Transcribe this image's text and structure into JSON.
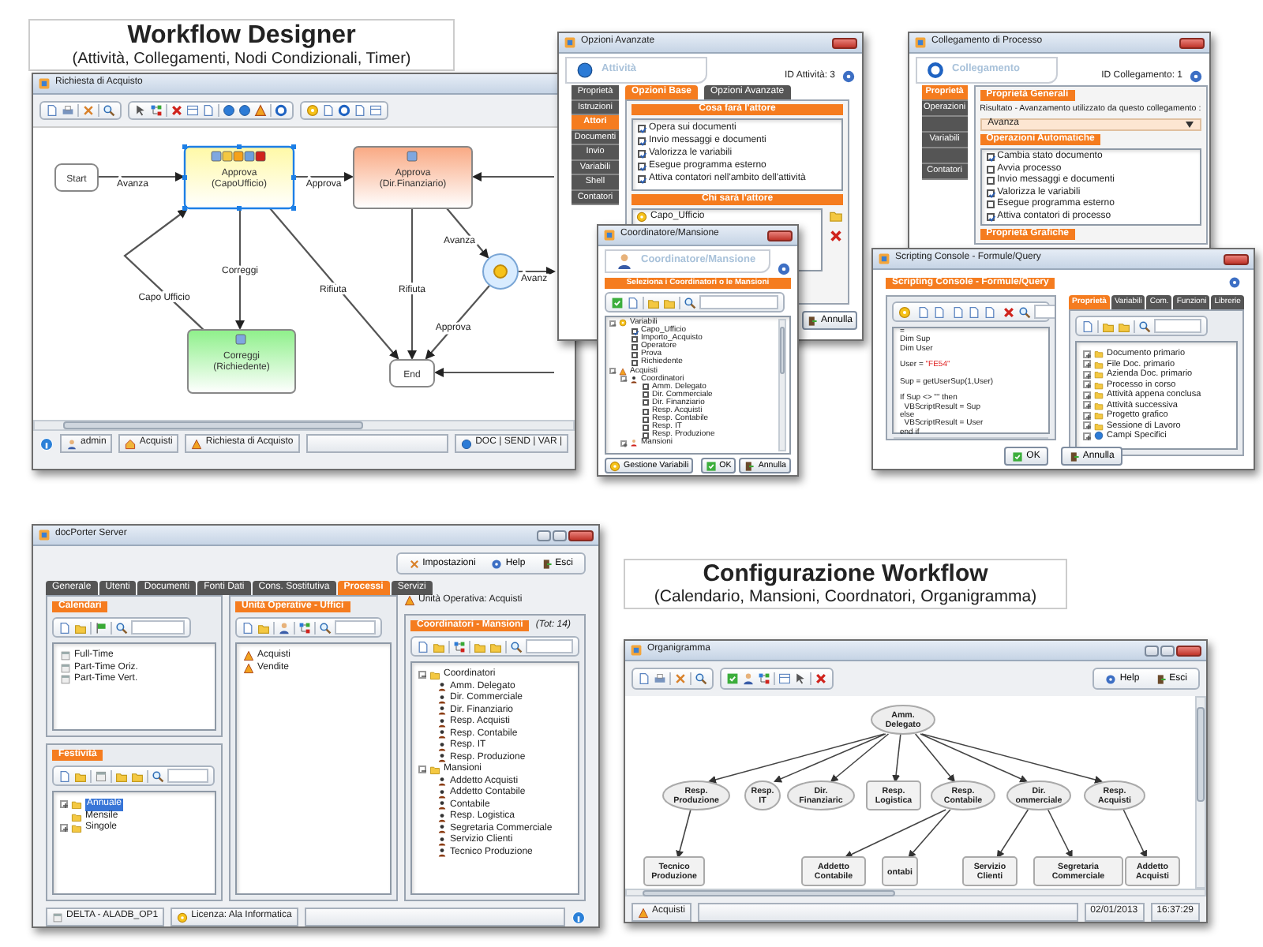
{
  "captions": [
    {
      "title": "Workflow Designer",
      "subtitle": "(Attività, Collegamenti, Nodi Condizionali, Timer)"
    },
    {
      "title": "Configurazione Workflow",
      "subtitle": "(Calendario, Mansioni, Coordnatori, Organigramma)"
    }
  ],
  "designer": {
    "title": "Richiesta di Acquisto",
    "nodes": [
      {
        "kind": "terminal",
        "label": "Start",
        "selected": false
      },
      {
        "kind": "activity",
        "label": "Approva",
        "sublabel": "(CapoUfficio)",
        "color": "#fff9a6",
        "selected": true
      },
      {
        "kind": "activity",
        "label": "Approva",
        "sublabel": "(Dir.Finanziario)",
        "color": "#f9a983",
        "selected": false
      },
      {
        "kind": "activity",
        "label": "Correggi",
        "sublabel": "(Richiedente)",
        "color": "#8ef08a",
        "selected": false
      },
      {
        "kind": "terminal",
        "label": "End",
        "selected": false
      },
      {
        "kind": "condition",
        "selected": false
      }
    ],
    "links": [
      {
        "kind": "link",
        "label": "Avanza"
      },
      {
        "kind": "link",
        "label": "Approva"
      },
      {
        "kind": "link"
      },
      {
        "kind": "link",
        "label": "Correggi"
      },
      {
        "kind": "link",
        "label": "Capo Ufficio"
      },
      {
        "kind": "link",
        "label": "Rifiuta"
      },
      {
        "kind": "link",
        "label": "Rifiuta"
      },
      {
        "kind": "link",
        "label": "Avanza"
      },
      {
        "kind": "link",
        "label": "Approva"
      },
      {
        "kind": "link",
        "label": "Avanz"
      },
      {
        "kind": "link"
      }
    ],
    "status": [
      "admin",
      "Acquisti",
      "Richiesta di Acquisto"
    ],
    "status_right": "DOC | SEND | VAR |"
  },
  "activity_dialog": {
    "title": "Opzioni Avanzate",
    "header": "Attività",
    "id_label": "ID Attività: 3",
    "side_tabs": [
      {
        "label": "Proprietà",
        "selected": false
      },
      {
        "label": "Istruzioni",
        "selected": false
      },
      {
        "label": "Attori",
        "selected": true
      },
      {
        "label": "Documenti",
        "selected": false
      },
      {
        "label": "Invio",
        "selected": false
      },
      {
        "label": "Variabili",
        "selected": false
      },
      {
        "label": "Shell",
        "selected": false
      },
      {
        "label": "Contatori",
        "selected": false
      }
    ],
    "tabs": [
      {
        "label": "Opzioni Base",
        "selected": true
      },
      {
        "label": "Opzioni Avanzate",
        "selected": false
      }
    ],
    "section_1": "Cosa farà l'attore",
    "options": [
      {
        "label": "Opera sui documenti",
        "checked": true
      },
      {
        "label": "Invio messaggi e documenti",
        "checked": true
      },
      {
        "label": "Valorizza le variabili",
        "checked": true
      },
      {
        "label": "Esegue programma esterno",
        "checked": true
      },
      {
        "label": "Attiva contatori nell'ambito dell'attività",
        "checked": true
      }
    ],
    "section_2": "Chi sarà l'attore",
    "actors": [
      "Capo_Ufficio"
    ],
    "buttons": [
      "Annulla"
    ]
  },
  "role_dialog": {
    "title": "Coordinatore/Mansione",
    "header": "Coordinatore/Mansione",
    "section": "Seleziona i Coordinatori o le Mansioni",
    "tree": [
      {
        "kind": "variables",
        "label": "Variabili",
        "expanded": true,
        "children": [
          {
            "label": "Capo_Ufficio",
            "checked": true
          },
          {
            "label": "Importo_Acquisto",
            "checked": false
          },
          {
            "label": "Operatore",
            "checked": false
          },
          {
            "label": "Prova",
            "checked": false
          },
          {
            "label": "Richiedente",
            "checked": false
          }
        ]
      },
      {
        "kind": "unit",
        "label": "Acquisti",
        "expanded": true,
        "children": [
          {
            "kind": "coordinator",
            "label": "Coordinatori",
            "expanded": true,
            "children": [
              {
                "label": "Amm. Delegato",
                "checked": false
              },
              {
                "label": "Dir. Commerciale",
                "checked": false
              },
              {
                "label": "Dir. Finanziario",
                "checked": false
              },
              {
                "label": "Resp. Acquisti",
                "checked": false
              },
              {
                "label": "Resp. Contabile",
                "checked": false
              },
              {
                "label": "Resp. IT",
                "checked": false
              },
              {
                "label": "Resp. Produzione",
                "checked": false
              }
            ]
          },
          {
            "kind": "role",
            "label": "Mansioni",
            "expanded": false
          }
        ]
      }
    ],
    "buttons": [
      "Gestione Variabili",
      "OK",
      "Annulla"
    ]
  },
  "link_dialog": {
    "title": "Collegamento di Processo",
    "header": "Collegamento",
    "id_label": "ID Collegamento: 1",
    "side_tabs": [
      {
        "kind": "tab",
        "label": "Proprietà",
        "selected": true
      },
      {
        "kind": "tab",
        "label": "Operazioni",
        "selected": false
      },
      {
        "kind": "blank",
        "selected": false
      },
      {
        "kind": "tab",
        "label": "Variabili",
        "selected": false
      },
      {
        "kind": "blank",
        "selected": false
      },
      {
        "kind": "tab",
        "label": "Contatori",
        "selected": false
      }
    ],
    "section_1": "Proprietà Generali",
    "result_label": "Risultato - Avanzamento utilizzato da questo collegamento :",
    "result_value": "Avanza",
    "section_2": "Operazioni Automatiche",
    "options": [
      {
        "label": "Cambia stato documento",
        "checked": true
      },
      {
        "label": "Avvia processo",
        "checked": false
      },
      {
        "label": "Invio messaggi e documenti",
        "checked": false
      },
      {
        "label": "Valorizza le variabili",
        "checked": true
      },
      {
        "label": "Esegue programma esterno",
        "checked": false
      },
      {
        "label": "Attiva contatori di processo",
        "checked": true
      }
    ],
    "section_3": "Proprietà Grafiche"
  },
  "script_dialog": {
    "title": "Scripting Console - Formule/Query",
    "header": "Scripting Console - Formule/Query",
    "code": [
      {
        "kind": "line",
        "text": "="
      },
      {
        "kind": "line",
        "text": "Dim Sup"
      },
      {
        "kind": "line",
        "text": "Dim User"
      },
      {
        "kind": "blank"
      },
      {
        "kind": "line",
        "text": "User = ",
        "literal": "\"FE54\""
      },
      {
        "kind": "blank"
      },
      {
        "kind": "line",
        "text": "Sup = getUserSup(1,User)"
      },
      {
        "kind": "blank"
      },
      {
        "kind": "line",
        "text": "If Sup <> \"\" then"
      },
      {
        "kind": "line",
        "text": "  VBScriptResult = Sup"
      },
      {
        "kind": "line",
        "text": "else"
      },
      {
        "kind": "line",
        "text": "  VBScriptResult = User"
      },
      {
        "kind": "line",
        "text": "end if"
      }
    ],
    "tabs": [
      {
        "label": "Proprietà",
        "selected": true
      },
      {
        "label": "Variabili",
        "selected": false
      },
      {
        "label": "Com.",
        "selected": false
      },
      {
        "label": "Funzioni",
        "selected": false
      },
      {
        "label": "Librerie",
        "selected": false
      }
    ],
    "tree": [
      {
        "kind": "folder",
        "label": "Documento primario"
      },
      {
        "kind": "folder",
        "label": "File Doc. primario"
      },
      {
        "kind": "folder",
        "label": "Azienda Doc. primario"
      },
      {
        "kind": "folder",
        "label": "Processo in corso"
      },
      {
        "kind": "folder",
        "label": "Attività appena conclusa"
      },
      {
        "kind": "folder",
        "label": "Attività successiva"
      },
      {
        "kind": "folder",
        "label": "Progetto grafico"
      },
      {
        "kind": "folder",
        "label": "Sessione di Lavoro"
      },
      {
        "kind": "special",
        "label": "Campi Specifici"
      }
    ],
    "buttons": [
      "OK",
      "Annulla"
    ]
  },
  "server": {
    "title": "docPorter Server",
    "toolbar": [
      "Impostazioni",
      "Help",
      "Esci"
    ],
    "tabs": [
      {
        "label": "Generale",
        "selected": false
      },
      {
        "label": "Utenti",
        "selected": false
      },
      {
        "label": "Documenti",
        "selected": false
      },
      {
        "label": "Fonti Dati",
        "selected": false
      },
      {
        "label": "Cons. Sostitutiva",
        "selected": false
      },
      {
        "label": "Processi",
        "selected": true
      },
      {
        "label": "Servizi",
        "selected": false
      }
    ],
    "calendars": {
      "title": "Calendari",
      "items": [
        "Full-Time",
        "Part-Time Oriz.",
        "Part-Time Vert."
      ]
    },
    "holidays": {
      "title": "Festività",
      "items": [
        {
          "label": "Annuale",
          "selected": true,
          "expanded": false
        },
        {
          "label": "Mensile",
          "selected": false
        },
        {
          "label": "Singole",
          "selected": false,
          "expanded": false
        }
      ]
    },
    "units": {
      "title": "Unità Operative - Uffici",
      "items": [
        "Acquisti",
        "Vendite"
      ]
    },
    "unit_caption": "Unità Operativa: Acquisti",
    "roles": {
      "title": "Coordinatori - Mansioni",
      "total": "(Tot: 14)",
      "groups": [
        {
          "label": "Coordinatori",
          "expanded": true,
          "children": [
            "Amm. Delegato",
            "Dir. Commerciale",
            "Dir. Finanziario",
            "Resp. Acquisti",
            "Resp. Contabile",
            "Resp. IT",
            "Resp. Produzione"
          ]
        },
        {
          "label": "Mansioni",
          "expanded": true,
          "children": [
            "Addetto Acquisti",
            "Addetto Contabile",
            "Contabile",
            "Resp. Logistica",
            "Segretaria Commerciale",
            "Servizio Clienti",
            "Tecnico Produzione"
          ]
        }
      ]
    },
    "status": [
      "DELTA - ALADB_OP1",
      "Licenza: Ala Informatica"
    ]
  },
  "org_chart": {
    "title": "Organigramma",
    "toolbar": [
      "Help",
      "Esci"
    ],
    "root": {
      "kind": "coordinator",
      "lines": [
        "Amm.",
        "Delegato"
      ],
      "children": [
        {
          "kind": "coordinator",
          "lines": [
            "Resp.",
            "Produzione"
          ],
          "children": [
            {
              "kind": "role",
              "lines": [
                "Tecnico",
                "Produzione"
              ]
            }
          ]
        },
        {
          "kind": "coordinator",
          "lines": [
            "Resp.",
            "IT"
          ]
        },
        {
          "kind": "coordinator",
          "lines": [
            "Dir.",
            "Finanziaric"
          ]
        },
        {
          "kind": "role",
          "lines": [
            "Resp.",
            "Logistica"
          ]
        },
        {
          "kind": "coordinator",
          "lines": [
            "Resp.",
            "Contabile"
          ],
          "children": [
            {
              "kind": "role",
              "lines": [
                "Addetto",
                "Contabile"
              ]
            },
            {
              "kind": "role",
              "lines": [
                "ontabi"
              ]
            }
          ]
        },
        {
          "kind": "coordinator",
          "lines": [
            "Dir.",
            "ommerciale"
          ],
          "children": [
            {
              "kind": "role",
              "lines": [
                "Servizio",
                "Clienti"
              ]
            },
            {
              "kind": "role",
              "lines": [
                "Segretaria",
                "Commerciale"
              ]
            }
          ]
        },
        {
          "kind": "coordinator",
          "lines": [
            "Resp.",
            "Acquisti"
          ],
          "children": [
            {
              "kind": "role",
              "lines": [
                "Addetto",
                "Acquisti"
              ]
            }
          ]
        }
      ]
    },
    "status": [
      "Acquisti",
      "02/01/2013",
      "16:37:29"
    ]
  }
}
